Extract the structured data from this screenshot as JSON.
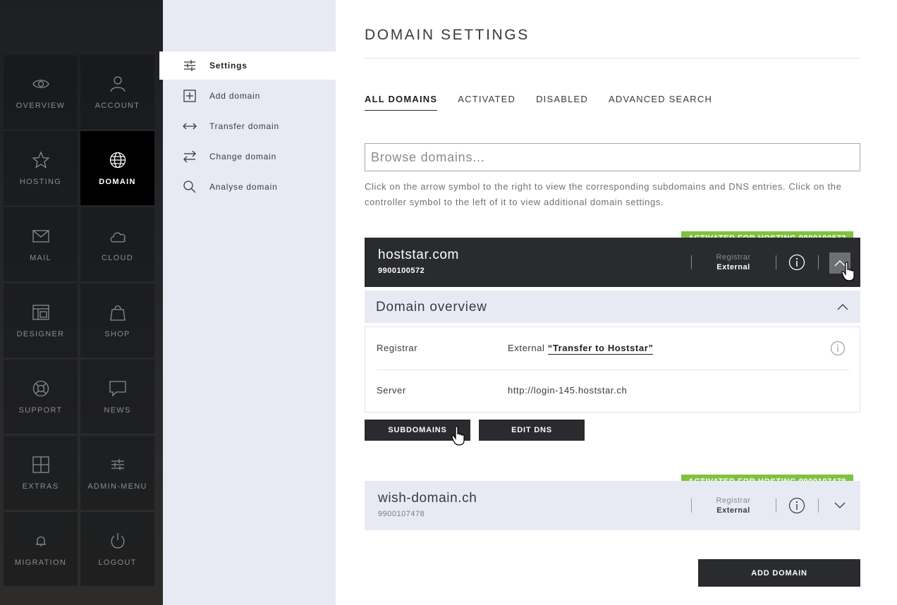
{
  "nav": {
    "tiles": [
      {
        "label": "OVERVIEW",
        "icon": "eye-icon"
      },
      {
        "label": "ACCOUNT",
        "icon": "user-icon"
      },
      {
        "label": "HOSTING",
        "icon": "star-icon"
      },
      {
        "label": "DOMAIN",
        "icon": "globe-icon",
        "active": true
      },
      {
        "label": "MAIL",
        "icon": "envelope-icon"
      },
      {
        "label": "CLOUD",
        "icon": "cloud-icon"
      },
      {
        "label": "DESIGNER",
        "icon": "layout-icon"
      },
      {
        "label": "SHOP",
        "icon": "shopping-bag-icon"
      },
      {
        "label": "SUPPORT",
        "icon": "lifebuoy-icon"
      },
      {
        "label": "NEWS",
        "icon": "speech-bubble-icon"
      },
      {
        "label": "EXTRAS",
        "icon": "grid-plus-icon"
      },
      {
        "label": "ADMIN-MENU",
        "icon": "sliders-icon"
      },
      {
        "label": "MIGRATION",
        "icon": "bell-icon"
      },
      {
        "label": "LOGOUT",
        "icon": "power-icon"
      }
    ]
  },
  "submenu": {
    "items": [
      {
        "label": "Settings",
        "icon": "sliders-icon",
        "active": true
      },
      {
        "label": "Add domain",
        "icon": "plus-square-icon"
      },
      {
        "label": "Transfer domain",
        "icon": "arrows-horizontal-icon"
      },
      {
        "label": "Change domain",
        "icon": "swap-arrows-icon"
      },
      {
        "label": "Analyse domain",
        "icon": "magnifier-icon"
      }
    ]
  },
  "main": {
    "title": "DOMAIN SETTINGS",
    "tabs": [
      {
        "label": "ALL DOMAINS",
        "active": true
      },
      {
        "label": "ACTIVATED"
      },
      {
        "label": "DISABLED"
      },
      {
        "label": "ADVANCED SEARCH"
      }
    ],
    "search": {
      "placeholder": "Browse domains..."
    },
    "hint": "Click on the arrow symbol to the right to view the corresponding subdomains and DNS entries. Click on the controller symbol to the left of it to view additional domain settings.",
    "domains": [
      {
        "badge": "ACTIVATED FOR HOSTING 9900100572",
        "name": "hoststar.com",
        "number": "9900100572",
        "registrar_label": "Registrar",
        "registrar_value": "External",
        "expanded": true
      },
      {
        "badge": "ACTIVATED FOR HOSTING 9900107478",
        "name": "wish-domain.ch",
        "number": "9900107478",
        "registrar_label": "Registrar",
        "registrar_value": "External",
        "expanded": false
      }
    ],
    "overview": {
      "title": "Domain overview",
      "rows": [
        {
          "label": "Registrar",
          "value": "External",
          "link": "“Transfer to Hoststar”"
        },
        {
          "label": "Server",
          "value": "http://login-145.hoststar.ch"
        }
      ]
    },
    "buttons": {
      "subdomains": "SUBDOMAINS",
      "edit_dns": "EDIT DNS",
      "add_domain": "ADD DOMAIN"
    }
  },
  "colors": {
    "nav_bg": "#232427",
    "nav_active": "#000000",
    "submenu_bg": "#e8eaf3",
    "card_dark": "#2a2b2f",
    "badge_green": "#7fc241"
  }
}
